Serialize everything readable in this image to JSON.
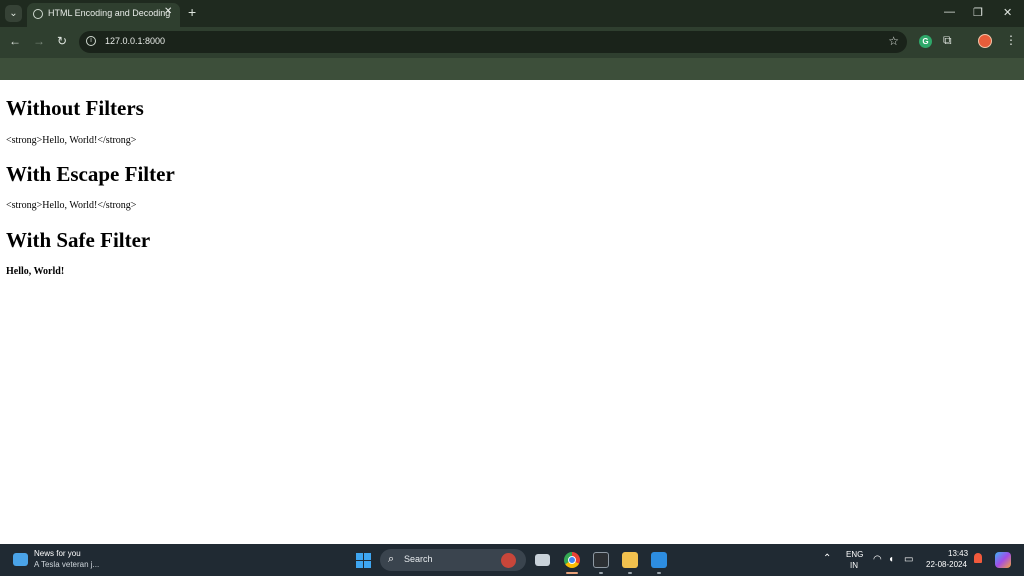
{
  "browser": {
    "tab_title": "HTML Encoding and Decoding",
    "url": "127.0.0.1:8000"
  },
  "page": {
    "sections": [
      {
        "heading": "Without Filters",
        "text": "<strong>Hello, World!</strong>"
      },
      {
        "heading": "With Escape Filter",
        "text": "<strong>Hello, World!</strong>"
      },
      {
        "heading": "With Safe Filter",
        "text": "Hello, World!"
      }
    ]
  },
  "taskbar": {
    "news_title": "News for you",
    "news_subtitle": "A Tesla veteran j...",
    "search_label": "Search",
    "language": "ENG",
    "region": "IN",
    "time": "13:43",
    "date": "22-08-2024"
  },
  "icons": {
    "tab_search": "chevron-down-icon",
    "favicon": "globe-icon",
    "tab_close": "close-icon",
    "new_tab": "plus-icon",
    "back": "arrow-left-icon",
    "forward": "arrow-right-icon",
    "reload": "reload-icon",
    "site_info": "info-icon",
    "bookmark": "star-icon",
    "extensions": "puzzle-icon",
    "menu": "more-vertical-icon"
  },
  "colors": {
    "title_bar": "#1f2a1f",
    "toolbar": "#2f3f2f",
    "bookmark_bar": "#3d4f3a",
    "taskbar": "#202a33"
  }
}
